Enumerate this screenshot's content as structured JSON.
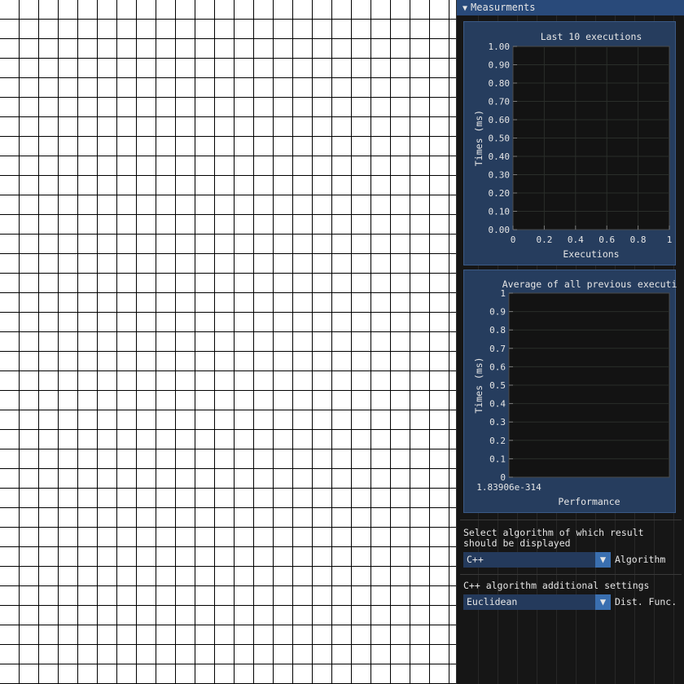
{
  "window": {
    "title": "Measurments"
  },
  "chart_data": [
    {
      "type": "line",
      "title": "Last 10 executions",
      "xlabel": "Executions",
      "ylabel": "Times (ms)",
      "xlim": [
        0,
        1
      ],
      "ylim": [
        0,
        1
      ],
      "xticks": [
        "0",
        "0.2",
        "0.4",
        "0.6",
        "0.8",
        "1"
      ],
      "yticks": [
        "0.00",
        "0.10",
        "0.20",
        "0.30",
        "0.40",
        "0.50",
        "0.60",
        "0.70",
        "0.80",
        "0.90",
        "1.00"
      ],
      "series": []
    },
    {
      "type": "bar",
      "title": "Average of all previous execution",
      "xlabel": "Performance",
      "ylabel": "Times (ms)",
      "ylim": [
        0,
        1
      ],
      "xticks": [
        "1.83906e-314"
      ],
      "yticks": [
        "0",
        "0.1",
        "0.2",
        "0.3",
        "0.4",
        "0.5",
        "0.6",
        "0.7",
        "0.8",
        "0.9",
        "1"
      ],
      "series": []
    }
  ],
  "algorithm": {
    "prompt": "Select algorithm of which result should be displayed",
    "prompt_line1": "Select algorithm of which result",
    "prompt_line2": "should be displayed",
    "selected": "C++",
    "label": "Algorithm"
  },
  "cpp_settings": {
    "heading": "C++ algorithm additional settings",
    "selected": "Euclidean",
    "label": "Dist. Func."
  },
  "icons": {
    "collapse": "triangle-down-icon",
    "dropdown": "triangle-down-icon"
  }
}
